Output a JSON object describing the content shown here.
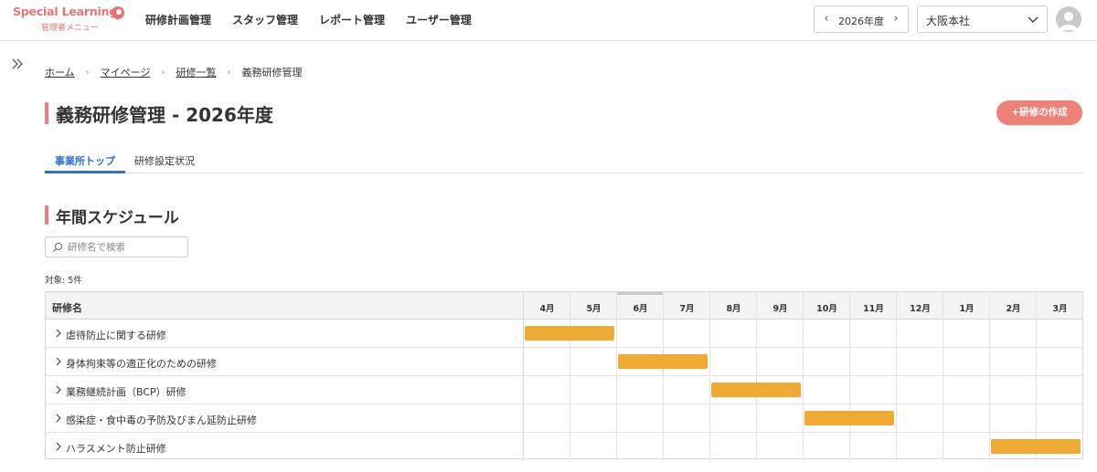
{
  "header": {
    "logo_main": "Special Learning",
    "logo_sub": "管理者メニュー",
    "nav": [
      "研修計画管理",
      "スタッフ管理",
      "レポート管理",
      "ユーザー管理"
    ],
    "year_label": "2026年度",
    "office_label": "大阪本社"
  },
  "breadcrumb": {
    "items": [
      "ホーム",
      "マイページ",
      "研修一覧"
    ],
    "current": "義務研修管理"
  },
  "page": {
    "title": "義務研修管理 - 2026年度",
    "create_button": "+研修の作成"
  },
  "tabs": {
    "active": "事業所トップ",
    "inactive": "研修設定状況"
  },
  "schedule": {
    "section_title": "年間スケジュール",
    "search_placeholder": "研修名で検索",
    "count_text": "対象: 5件",
    "name_header": "研修名",
    "months": [
      "4月",
      "5月",
      "6月",
      "7月",
      "8月",
      "9月",
      "10月",
      "11月",
      "12月",
      "1月",
      "2月",
      "3月"
    ],
    "current_month": "6月",
    "rows": [
      {
        "name": "虐待防止に関する研修",
        "start_month": "4月",
        "end_month": "5月"
      },
      {
        "name": "身体拘束等の適正化のための研修",
        "start_month": "6月",
        "end_month": "7月"
      },
      {
        "name": "業務継続計画（BCP）研修",
        "start_month": "8月",
        "end_month": "9月"
      },
      {
        "name": "感染症・食中毒の予防及びまん延防止研修",
        "start_month": "10月",
        "end_month": "11月"
      },
      {
        "name": "ハラスメント防止研修",
        "start_month": "2月",
        "end_month": "3月"
      }
    ]
  },
  "colors": {
    "accent": "#ec7e7e",
    "tab_active": "#2e6fd1",
    "bar": "#eeaa33",
    "create_button": "#f08179"
  }
}
